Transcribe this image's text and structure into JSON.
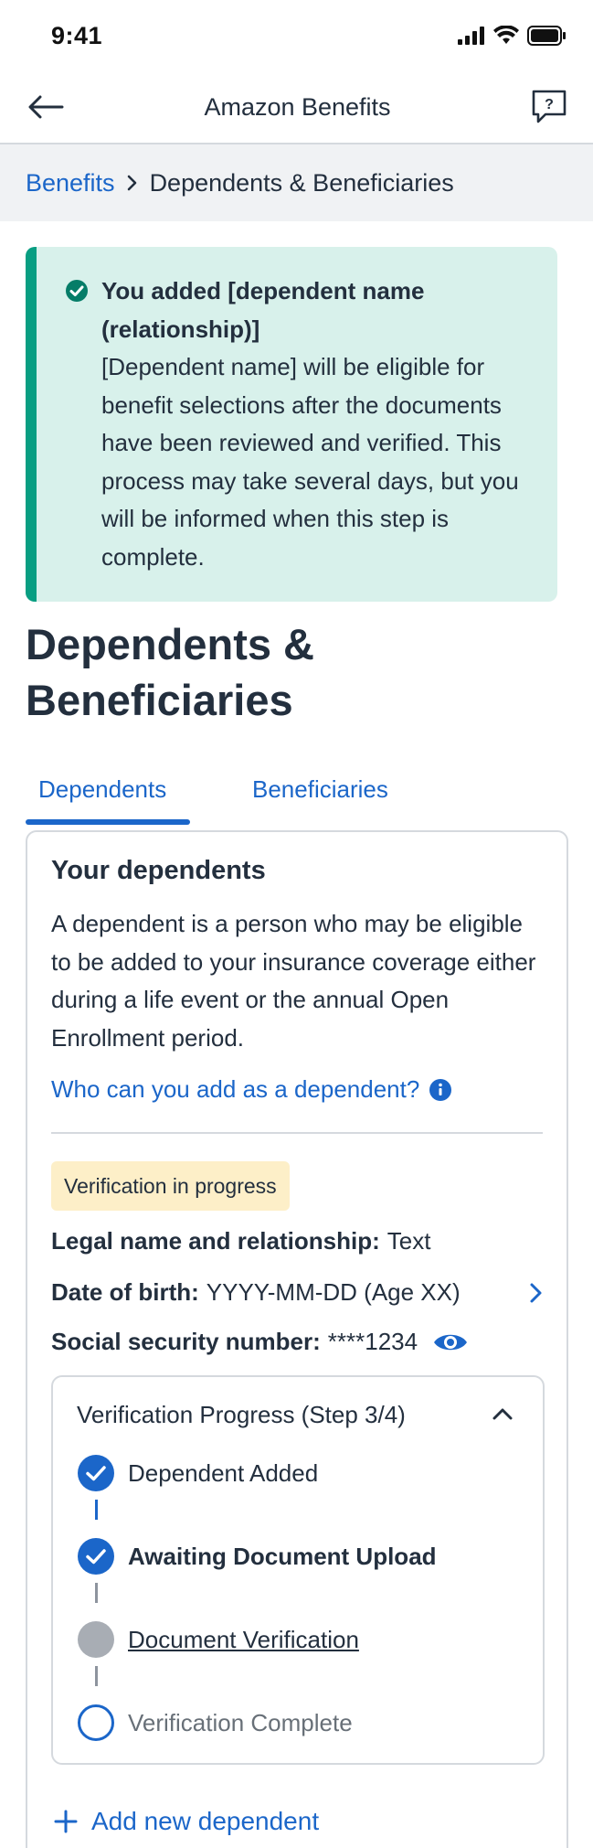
{
  "status_bar": {
    "time": "9:41"
  },
  "header": {
    "title": "Amazon Benefits"
  },
  "breadcrumb": {
    "parent": "Benefits",
    "current": "Dependents & Beneficiaries"
  },
  "alert": {
    "title": "You added [dependent name (relationship)]",
    "body": "[Dependent name] will be eligible for benefit selections after the documents have been reviewed and verified. This process may take several days, but you will be informed when this step is complete."
  },
  "page_title": "Dependents & Beneficiaries",
  "tabs": [
    {
      "label": "Dependents",
      "active": true
    },
    {
      "label": "Beneficiaries",
      "active": false
    }
  ],
  "card": {
    "title": "Your dependents",
    "description": "A dependent is a person who may be eligible to be added to your insurance coverage either during a life event or the annual Open Enrollment period.",
    "help_link": "Who can you add as a dependent?",
    "dependent": {
      "status_badge": "Verification in progress",
      "name_label": "Legal name and relationship:",
      "name_value": "Text",
      "dob_label": "Date of birth:",
      "dob_value": "YYYY-MM-DD (Age XX)",
      "ssn_label": "Social security number:",
      "ssn_value": "****1234"
    },
    "verification": {
      "title": "Verification Progress (Step 3/4)",
      "steps": [
        {
          "label": "Dependent Added",
          "state": "complete"
        },
        {
          "label": "Awaiting Document Upload",
          "state": "complete"
        },
        {
          "label": "Document Verification",
          "state": "current"
        },
        {
          "label": "Verification Complete",
          "state": "pending"
        }
      ]
    },
    "add_button": "Add new dependent"
  },
  "colors": {
    "accent": "#1b66c9",
    "success": "#089e82",
    "alert_bg": "#d8f1eb",
    "badge_bg": "#fdefc8"
  }
}
